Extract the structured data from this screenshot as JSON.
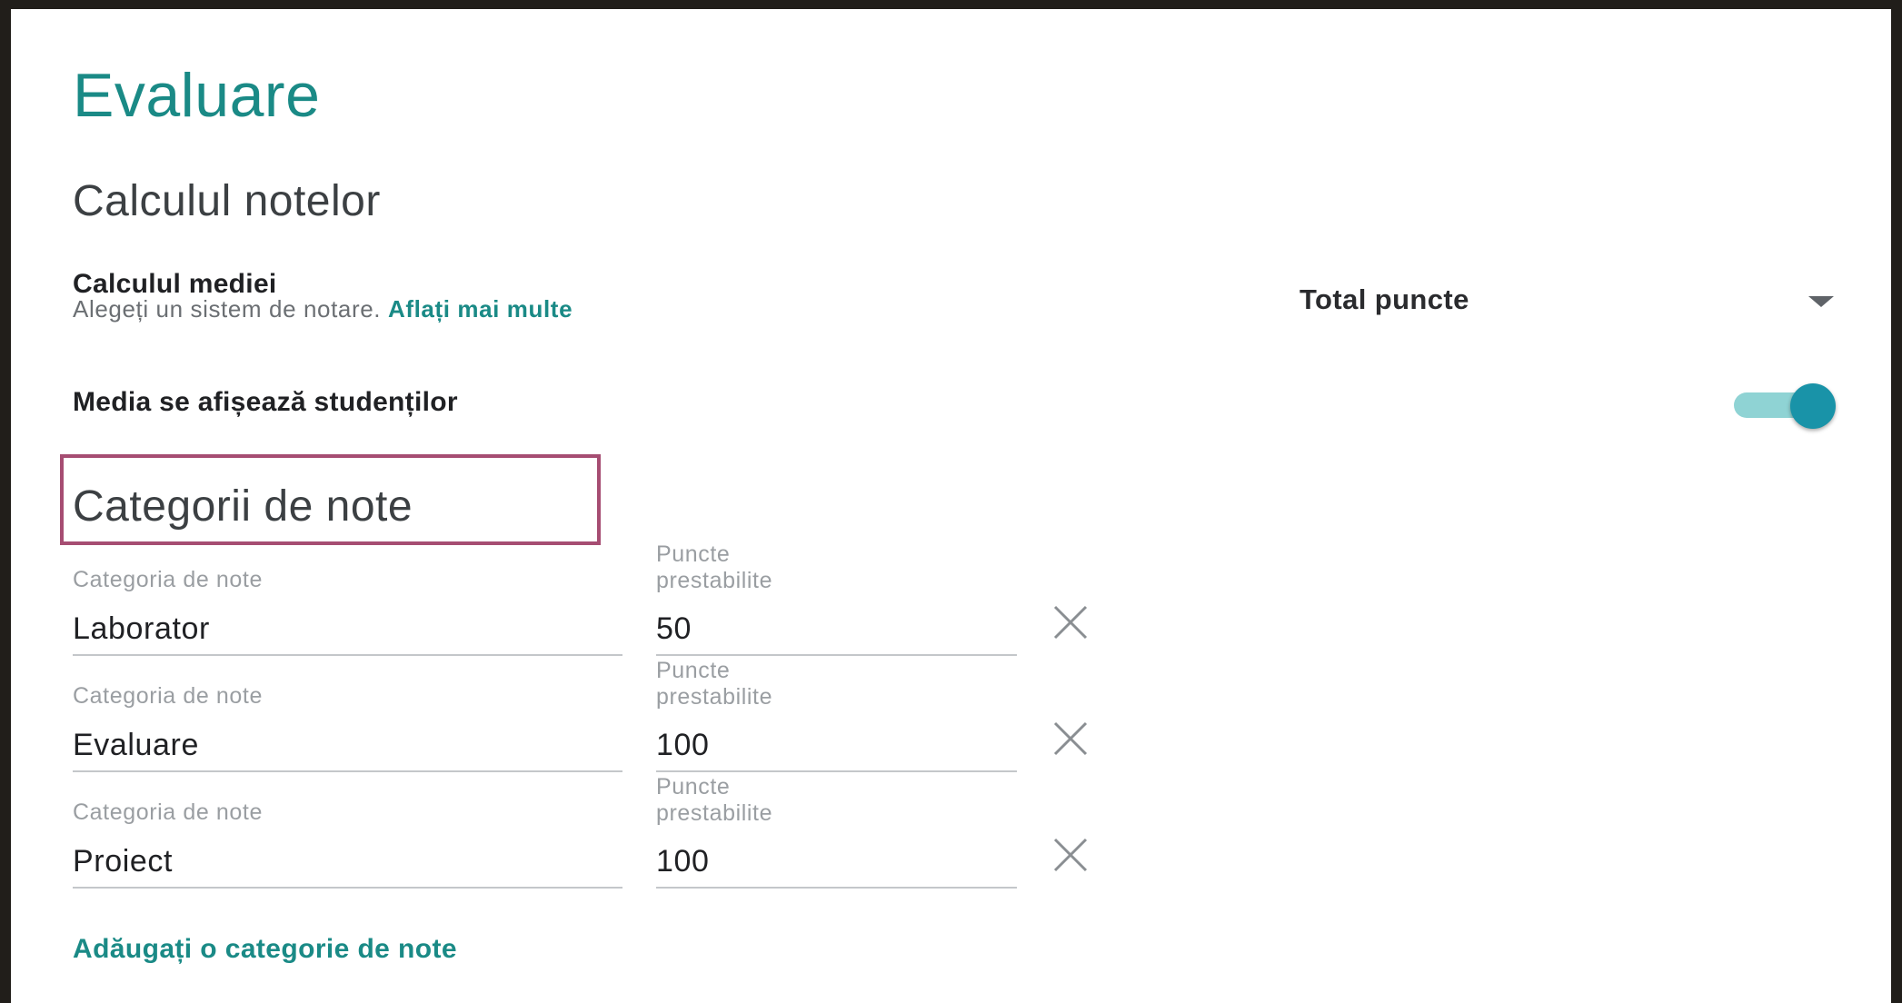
{
  "page": {
    "title": "Evaluare"
  },
  "grade_calculation": {
    "section_title": "Calculul notelor",
    "average_label": "Calculul mediei",
    "average_hint": "Alegeți un sistem de notare.",
    "learn_more_link": "Aflați mai multe",
    "average_select": {
      "selected": "Total puncte",
      "icon": "chevron-down-icon"
    },
    "show_to_students_label": "Media se afișează studenților",
    "show_to_students_enabled": true
  },
  "grade_categories": {
    "section_title": "Categorii de note",
    "category_label": "Categoria de note",
    "points_label_line1": "Puncte",
    "points_label_line2": "prestabilite",
    "rows": [
      {
        "category": "Laborator",
        "points": "50"
      },
      {
        "category": "Evaluare",
        "points": "100"
      },
      {
        "category": "Proiect",
        "points": "100"
      }
    ],
    "add_category_link": "Adăugați o categorie de note"
  },
  "colors": {
    "accent": "#1a8a86",
    "toggle_thumb": "#1993a8",
    "toggle_track": "#8fd3d4",
    "highlight_border": "#a64d72",
    "frame_background": "#211e1a"
  }
}
